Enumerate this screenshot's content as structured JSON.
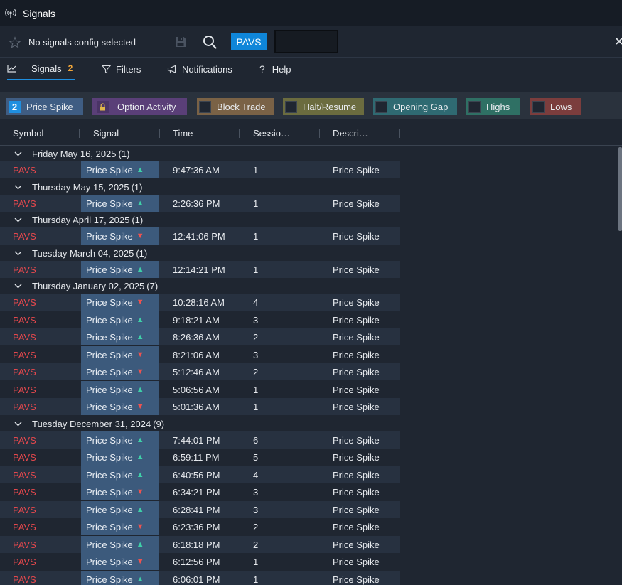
{
  "window": {
    "title": "Signals"
  },
  "toolbar": {
    "config_label": "No signals config selected",
    "symbol_chip": "PAVS",
    "symbol_input_value": ""
  },
  "tabs": [
    {
      "label": "Signals",
      "badge": "2"
    },
    {
      "label": "Filters"
    },
    {
      "label": "Notifications"
    },
    {
      "label": "Help"
    }
  ],
  "chips": [
    {
      "label": "Price Spike",
      "count": "2",
      "color": "#3f5d83",
      "count_color": "#1f8fe0"
    },
    {
      "label": "Option Activity",
      "color": "#5a3f78",
      "locked": true
    },
    {
      "label": "Block Trade",
      "color": "#7a6246"
    },
    {
      "label": "Halt/Resume",
      "color": "#6b6c3f"
    },
    {
      "label": "Opening Gap",
      "color": "#2f6a72"
    },
    {
      "label": "Highs",
      "color": "#2f7064"
    },
    {
      "label": "Lows",
      "color": "#7b3d3d"
    }
  ],
  "columns": [
    "Symbol",
    "Signal",
    "Time",
    "Sessio…",
    "Descri…"
  ],
  "groups": [
    {
      "date": "Friday May 16, 2025",
      "count": "(1)",
      "rows": [
        {
          "symbol": "PAVS",
          "signal": "Price Spike",
          "dir": "up",
          "time": "9:47:36 AM",
          "session": "1",
          "desc": "Price Spike"
        }
      ]
    },
    {
      "date": "Thursday May 15, 2025",
      "count": "(1)",
      "rows": [
        {
          "symbol": "PAVS",
          "signal": "Price Spike",
          "dir": "up",
          "time": "2:26:36 PM",
          "session": "1",
          "desc": "Price Spike"
        }
      ]
    },
    {
      "date": "Thursday April 17, 2025",
      "count": "(1)",
      "rows": [
        {
          "symbol": "PAVS",
          "signal": "Price Spike",
          "dir": "down",
          "time": "12:41:06 PM",
          "session": "1",
          "desc": "Price Spike"
        }
      ]
    },
    {
      "date": "Tuesday March 04, 2025",
      "count": "(1)",
      "rows": [
        {
          "symbol": "PAVS",
          "signal": "Price Spike",
          "dir": "up",
          "time": "12:14:21 PM",
          "session": "1",
          "desc": "Price Spike"
        }
      ]
    },
    {
      "date": "Thursday January 02, 2025",
      "count": "(7)",
      "rows": [
        {
          "symbol": "PAVS",
          "signal": "Price Spike",
          "dir": "down",
          "time": "10:28:16 AM",
          "session": "4",
          "desc": "Price Spike"
        },
        {
          "symbol": "PAVS",
          "signal": "Price Spike",
          "dir": "up",
          "time": "9:18:21 AM",
          "session": "3",
          "desc": "Price Spike"
        },
        {
          "symbol": "PAVS",
          "signal": "Price Spike",
          "dir": "up",
          "time": "8:26:36 AM",
          "session": "2",
          "desc": "Price Spike"
        },
        {
          "symbol": "PAVS",
          "signal": "Price Spike",
          "dir": "down",
          "time": "8:21:06 AM",
          "session": "3",
          "desc": "Price Spike"
        },
        {
          "symbol": "PAVS",
          "signal": "Price Spike",
          "dir": "down",
          "time": "5:12:46 AM",
          "session": "2",
          "desc": "Price Spike"
        },
        {
          "symbol": "PAVS",
          "signal": "Price Spike",
          "dir": "up",
          "time": "5:06:56 AM",
          "session": "1",
          "desc": "Price Spike"
        },
        {
          "symbol": "PAVS",
          "signal": "Price Spike",
          "dir": "down",
          "time": "5:01:36 AM",
          "session": "1",
          "desc": "Price Spike"
        }
      ]
    },
    {
      "date": "Tuesday December 31, 2024",
      "count": "(9)",
      "rows": [
        {
          "symbol": "PAVS",
          "signal": "Price Spike",
          "dir": "up",
          "time": "7:44:01 PM",
          "session": "6",
          "desc": "Price Spike"
        },
        {
          "symbol": "PAVS",
          "signal": "Price Spike",
          "dir": "up",
          "time": "6:59:11 PM",
          "session": "5",
          "desc": "Price Spike"
        },
        {
          "symbol": "PAVS",
          "signal": "Price Spike",
          "dir": "up",
          "time": "6:40:56 PM",
          "session": "4",
          "desc": "Price Spike"
        },
        {
          "symbol": "PAVS",
          "signal": "Price Spike",
          "dir": "down",
          "time": "6:34:21 PM",
          "session": "3",
          "desc": "Price Spike"
        },
        {
          "symbol": "PAVS",
          "signal": "Price Spike",
          "dir": "up",
          "time": "6:28:41 PM",
          "session": "3",
          "desc": "Price Spike"
        },
        {
          "symbol": "PAVS",
          "signal": "Price Spike",
          "dir": "down",
          "time": "6:23:36 PM",
          "session": "2",
          "desc": "Price Spike"
        },
        {
          "symbol": "PAVS",
          "signal": "Price Spike",
          "dir": "up",
          "time": "6:18:18 PM",
          "session": "2",
          "desc": "Price Spike"
        },
        {
          "symbol": "PAVS",
          "signal": "Price Spike",
          "dir": "down",
          "time": "6:12:56 PM",
          "session": "1",
          "desc": "Price Spike"
        },
        {
          "symbol": "PAVS",
          "signal": "Price Spike",
          "dir": "up",
          "time": "6:06:01 PM",
          "session": "1",
          "desc": "Price Spike"
        }
      ]
    }
  ]
}
